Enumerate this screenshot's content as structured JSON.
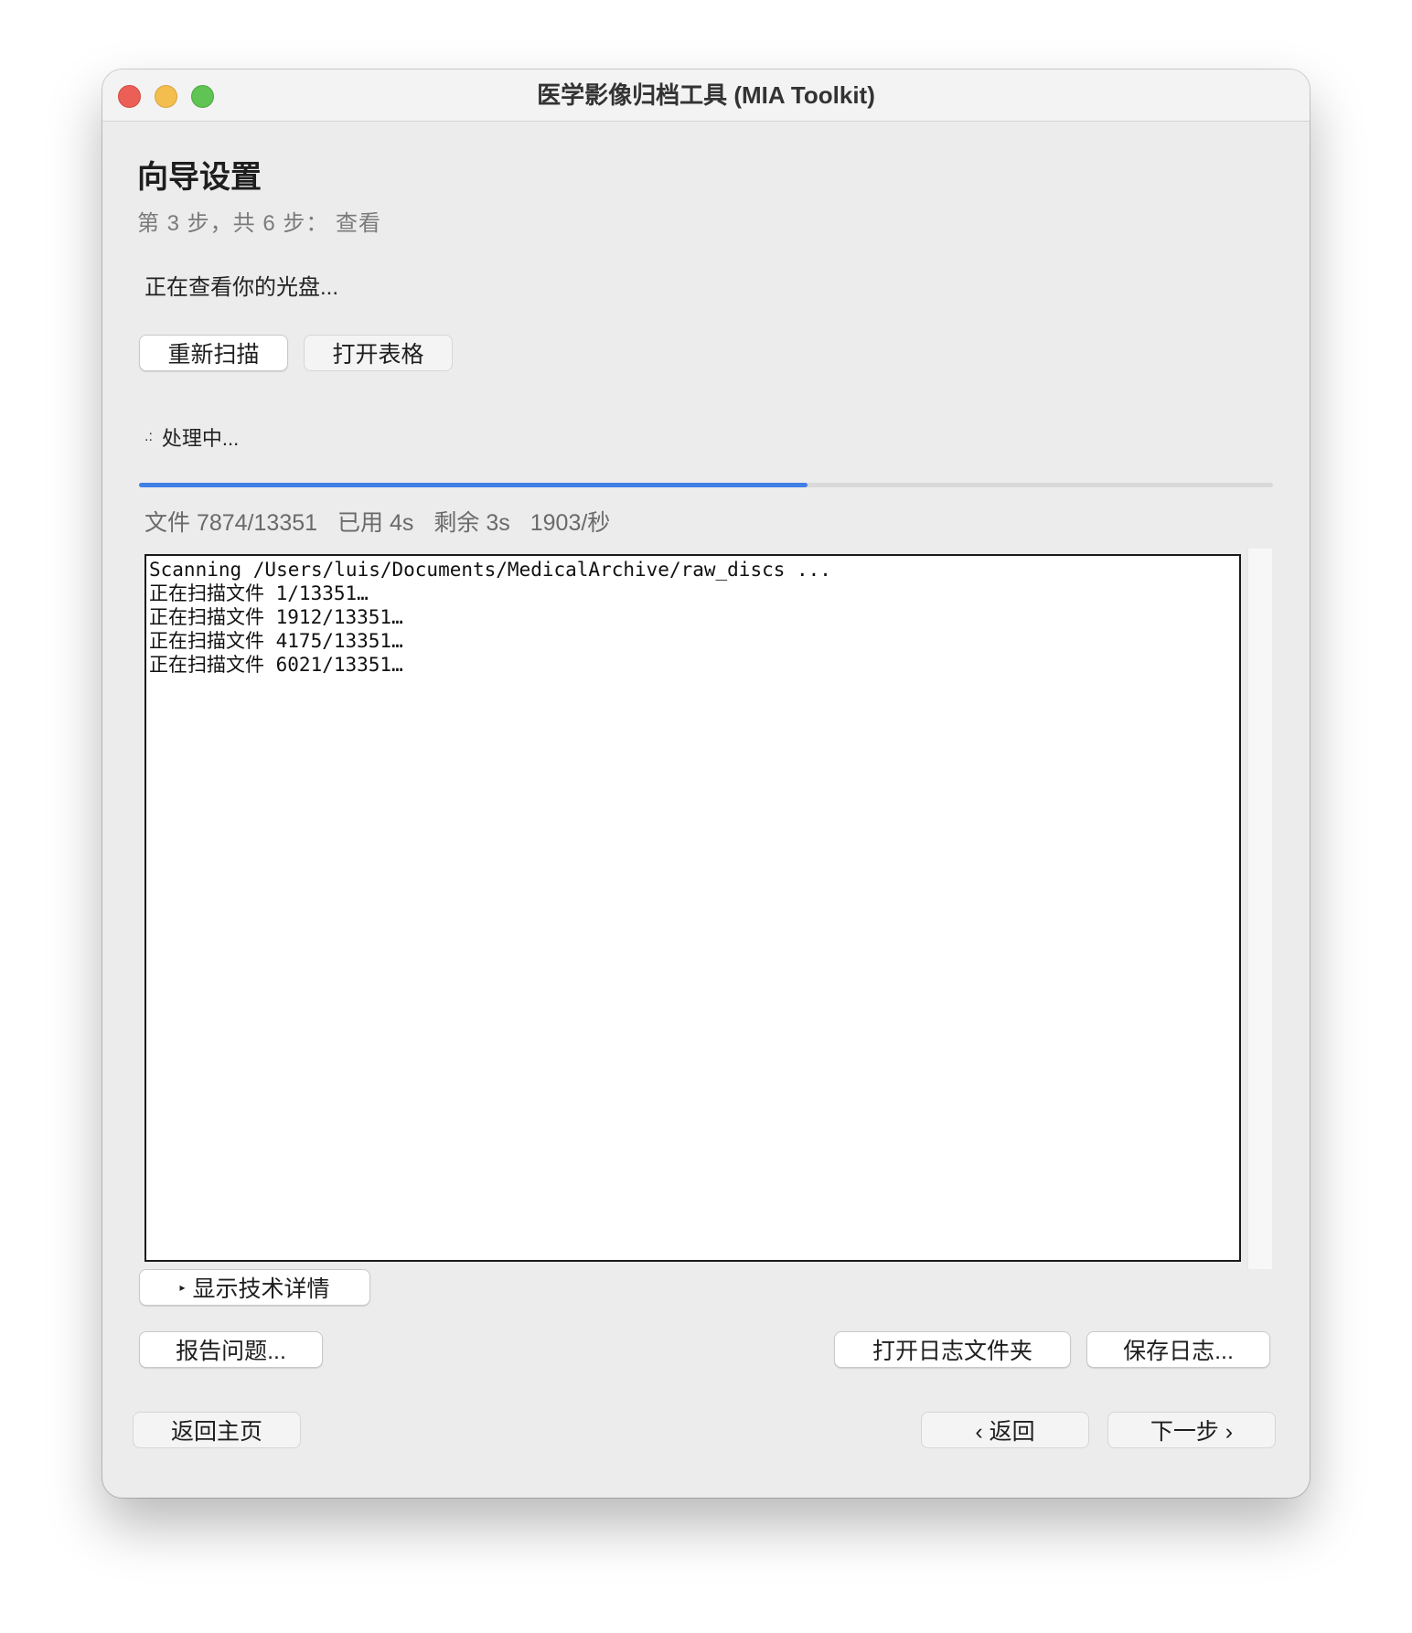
{
  "window": {
    "title": "医学影像归档工具 (MIA Toolkit)"
  },
  "wizard": {
    "heading": "向导设置",
    "step": "第 3 步，共 6 步：  查看",
    "status_message": "正在查看你的光盘..."
  },
  "actions": {
    "rescan_label": "重新扫描",
    "open_table_label": "打开表格"
  },
  "progress": {
    "spinner_glyph": ".:",
    "label": "处理中...",
    "fraction": 0.5897,
    "files": "文件 7874/13351",
    "elapsed": "已用 4s",
    "remaining": "剩余 3s",
    "rate": "1903/秒",
    "accent_color": "#3f7fe6"
  },
  "log": {
    "lines": [
      "Scanning /Users/luis/Documents/MedicalArchive/raw_discs ...",
      "正在扫描文件 1/13351…",
      "正在扫描文件 1912/13351…",
      "正在扫描文件 4175/13351…",
      "正在扫描文件 6021/13351…"
    ]
  },
  "details": {
    "toggle_label": "显示技术详情"
  },
  "footer": {
    "report_issue_label": "报告问题...",
    "open_log_folder_label": "打开日志文件夹",
    "save_log_label": "保存日志...",
    "home_label": "返回主页",
    "back_label": "‹ 返回",
    "next_label": "下一步 ›"
  }
}
